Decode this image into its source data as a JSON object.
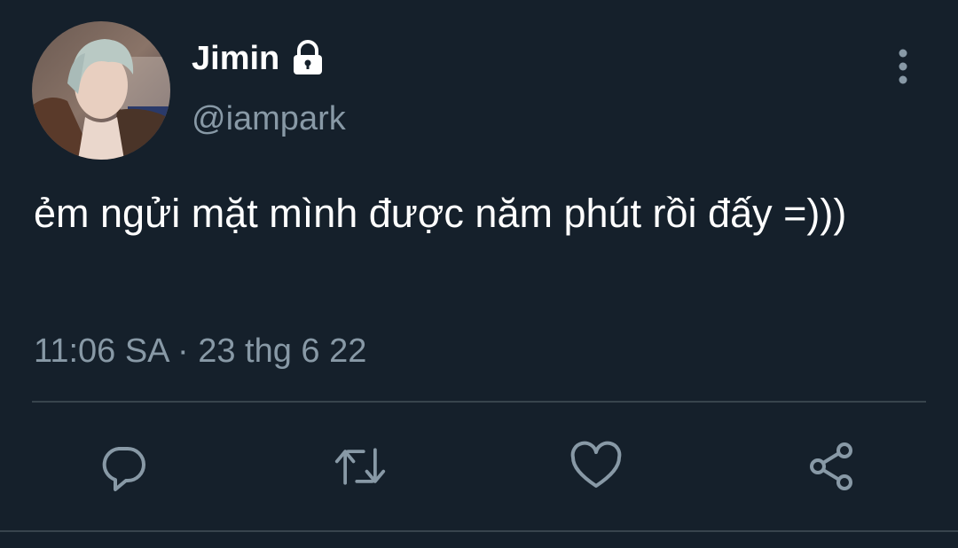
{
  "user": {
    "display_name": "Jimin",
    "handle": "@iampark",
    "protected": true
  },
  "tweet": {
    "text": "ẻm ngửi mặt mình được năm phút rồi đấy =)))",
    "timestamp": "11:06 SA · 23 thg 6 22"
  },
  "actions": {
    "reply_icon": "reply-icon",
    "retweet_icon": "retweet-icon",
    "like_icon": "heart-icon",
    "share_icon": "share-icon"
  },
  "colors": {
    "background": "#15202b",
    "primary_text": "#ffffff",
    "secondary_text": "#8899a6",
    "divider": "#38444d",
    "icon": "#8899a6"
  }
}
